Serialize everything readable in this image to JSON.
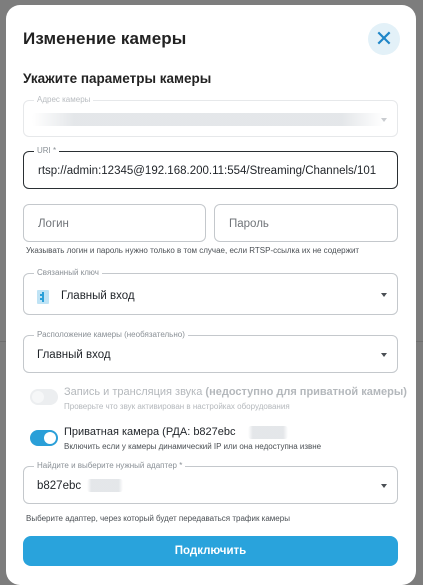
{
  "dialog": {
    "title": "Изменение камеры",
    "close_icon": "close-icon",
    "section_title": "Укажите параметры камеры"
  },
  "fields": {
    "address": {
      "label": "Адрес камеры",
      "value": ""
    },
    "uri": {
      "label": "URI *",
      "value": "rtsp://admin:12345@192.168.200.11:554/Streaming/Channels/101"
    },
    "login": {
      "placeholder": "Логин"
    },
    "password": {
      "placeholder": "Пароль"
    },
    "credentials_hint": "Указывать логин и пароль нужно только в том случае, если RTSP-ссылка их не содержит",
    "linked_key": {
      "label": "Связанный ключ",
      "value": "Главный вход",
      "icon": "key-icon"
    },
    "camera_location": {
      "label": "Расположение камеры (необязательно)",
      "value": "Главный вход"
    },
    "adapter": {
      "label": "Найдите и выберите нужный адаптер *",
      "value": "b827ebc"
    },
    "adapter_hint": "Выберите адаптер, через который будет передаваться трафик камеры"
  },
  "options": {
    "audio": {
      "title": "Запись и трансляция звука",
      "title_suffix": "(недоступно для приватной камеры)",
      "subtitle": "Проверьте что звук активирован в настройках оборудования",
      "enabled": false,
      "disabled": true
    },
    "private": {
      "title": "Приватная камера (РДА: b827ebc",
      "subtitle": "Включить если у камеры динамический IP или она недоступна извне",
      "enabled": true
    }
  },
  "actions": {
    "connect_label": "Подключить"
  },
  "colors": {
    "accent": "#29a3dc",
    "close_bg": "#e3f1f8",
    "overlay": "#7d7d7d"
  }
}
